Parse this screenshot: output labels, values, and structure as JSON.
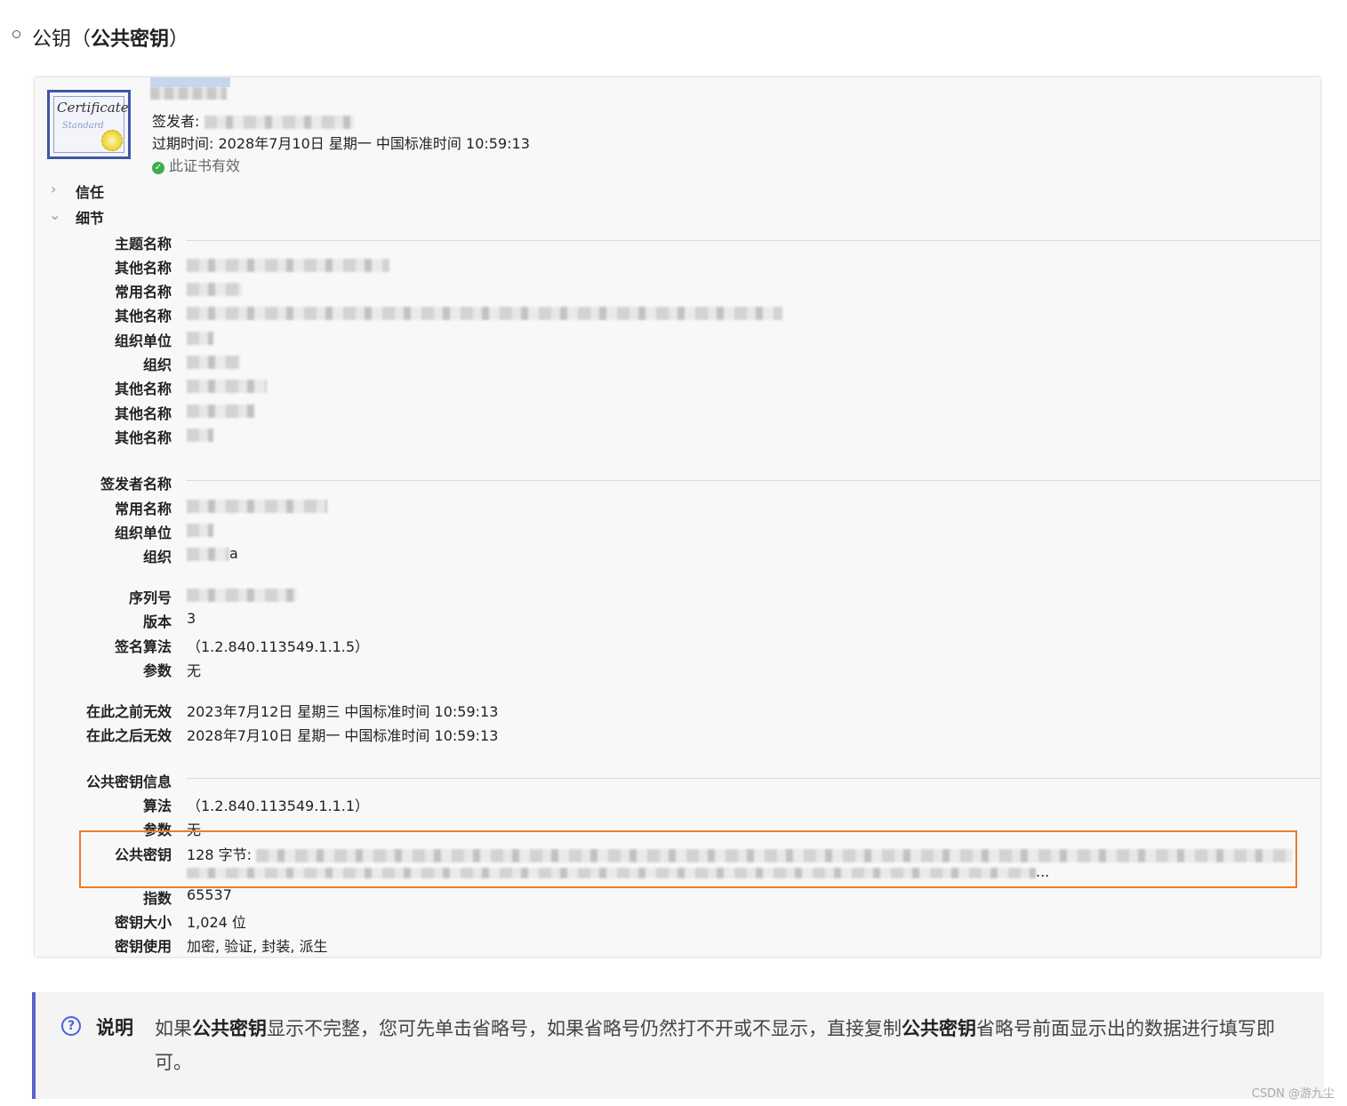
{
  "heading": {
    "prefix": "公钥（",
    "bold": "公共密钥",
    "suffix": "）"
  },
  "certificate": {
    "icon_title": "Certificate",
    "icon_sub": "Standard",
    "issuer_label": "签发者:",
    "expiry_label": "过期时间:",
    "expiry_value": "2028年7月10日 星期一 中国标准时间 10:59:13",
    "valid_text": "此证书有效"
  },
  "sections": {
    "trust": "信任",
    "details": "细节"
  },
  "subject": {
    "header": "主题名称",
    "rows": [
      {
        "label": "其他名称"
      },
      {
        "label": "常用名称"
      },
      {
        "label": "其他名称"
      },
      {
        "label": "组织单位"
      },
      {
        "label": "组织"
      },
      {
        "label": "其他名称"
      },
      {
        "label": "其他名称"
      },
      {
        "label": "其他名称"
      }
    ]
  },
  "issuer": {
    "header": "签发者名称",
    "rows": [
      {
        "label": "常用名称"
      },
      {
        "label": "组织单位"
      },
      {
        "label": "组织",
        "tail": "a"
      }
    ]
  },
  "info": {
    "serial_label": "序列号",
    "version_label": "版本",
    "version_value": "3",
    "sigalg_label": "签名算法",
    "sigalg_value": "（1.2.840.113549.1.1.5）",
    "params_label": "参数",
    "params_value": "无",
    "not_before_label": "在此之前无效",
    "not_before_value": "2023年7月12日 星期三 中国标准时间 10:59:13",
    "not_after_label": "在此之后无效",
    "not_after_value": "2028年7月10日 星期一 中国标准时间 10:59:13"
  },
  "pubkey": {
    "header": "公共密钥信息",
    "alg_label": "算法",
    "alg_value": "（1.2.840.113549.1.1.1）",
    "params_label": "参数",
    "params_value": "无",
    "key_label": "公共密钥",
    "key_prefix": "128 字节:",
    "key_ellipsis": "...",
    "exp_label": "指数",
    "exp_value": "65537",
    "size_label": "密钥大小",
    "size_value": "1,024 位",
    "usage_label": "密钥使用",
    "usage_value": "加密, 验证, 封装, 派生"
  },
  "note": {
    "label": "说明",
    "t1": "如果",
    "b1": "公共密钥",
    "t2": "显示不完整，您可先单击省略号，如果省略号仍然打不开或不显示，直接复制",
    "b2": "公共密钥",
    "t3": "省略号前面显示出的数据进行填写即可。"
  },
  "watermark": "CSDN @游九尘",
  "colors": {
    "highlight": "#f07a2c",
    "note_bar": "#5a63c7",
    "valid_check": "#3dae4a"
  }
}
